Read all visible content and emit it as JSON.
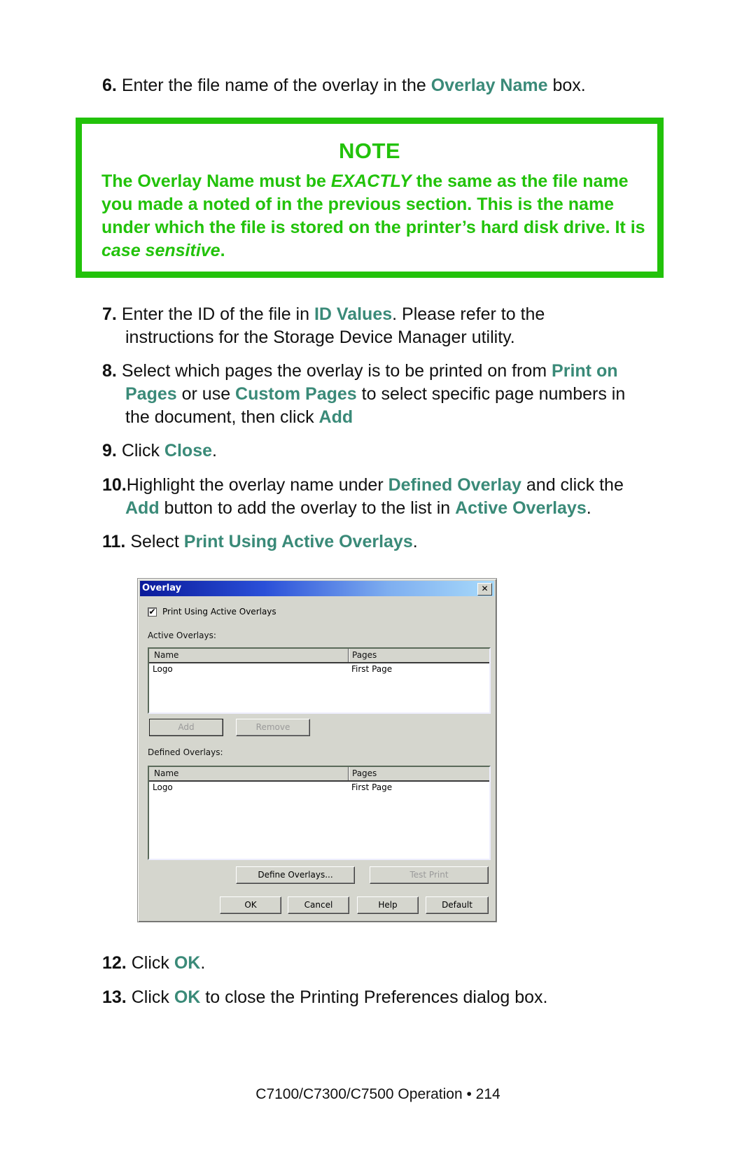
{
  "steps": {
    "s6": {
      "num": "6.",
      "pre": "Enter the file name of the overlay in the ",
      "hl": "Overlay Name",
      "post": " box."
    },
    "s7": {
      "num": "7.",
      "pre": "Enter the ID of the file in ",
      "hl": "ID Values",
      "post": ". Please refer to the",
      "line2": "instructions for the Storage Device Manager utility."
    },
    "s8": {
      "num": "8.",
      "pre": "Select which pages the overlay is to be printed on from ",
      "hl1": "Print on",
      "hl1b": "Pages",
      "mid": " or use ",
      "hl2": "Custom Pages",
      "post": " to select specific page numbers in",
      "line3": "the document, then click ",
      "hl3": "Add"
    },
    "s9": {
      "num": "9.",
      "pre": "Click ",
      "hl": "Close",
      "post": "."
    },
    "s10": {
      "num": "10.",
      "pre": "Highlight the overlay name under ",
      "hl1": "Defined Overlay",
      "mid": " and click the",
      "hl2": "Add",
      "mid2": " button to add the overlay to the list in ",
      "hl3": "Active Overlays",
      "post": "."
    },
    "s11": {
      "num": "11.",
      "pre": "Select ",
      "hl": "Print Using Active Overlays",
      "post": "."
    },
    "s12": {
      "num": "12.",
      "pre": "Click ",
      "hl": "OK",
      "post": "."
    },
    "s13": {
      "num": "13.",
      "pre": "Click ",
      "hl": "OK",
      "post": " to close the Printing Preferences dialog box."
    }
  },
  "note": {
    "title": "NOTE",
    "p1": "The Overlay Name must be ",
    "em1": "EXACTLY",
    "p2": " the same as the file name you made a noted of in the previous section. This is the name under which the file is stored on the printer’s hard disk drive. It is ",
    "em2": "case sensitive",
    "p3": "."
  },
  "dialog": {
    "title": "Overlay",
    "close": "✕",
    "checkbox_label": "Print Using Active Overlays",
    "checkbox_checked": true,
    "checkbox_mark": "✔",
    "active_label": "Active Overlays:",
    "defined_label": "Defined Overlays:",
    "columns": [
      "Name",
      "Pages"
    ],
    "active_rows": [
      {
        "name": "Logo",
        "pages": "First Page"
      }
    ],
    "defined_rows": [
      {
        "name": "Logo",
        "pages": "First Page"
      }
    ],
    "buttons": {
      "add": "Add",
      "remove": "Remove",
      "define": "Define Overlays...",
      "test_print": "Test Print",
      "ok": "OK",
      "cancel": "Cancel",
      "help": "Help",
      "default": "Default"
    }
  },
  "colors": {
    "highlight": "#3a8a78",
    "note_green": "#22c20a"
  },
  "footer": "C7100/C7300/C7500  Operation • 214"
}
